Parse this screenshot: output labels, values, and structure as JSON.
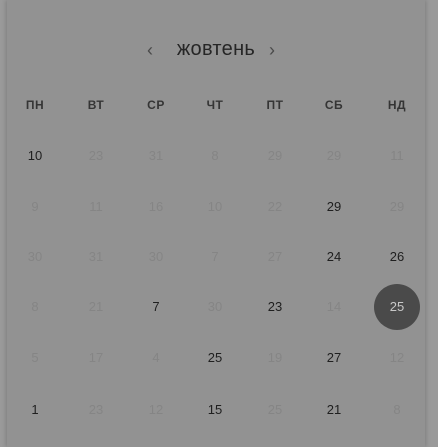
{
  "header": {
    "month": "жовтень",
    "prev_icon": "chevron-left-icon",
    "next_icon": "chevron-right-icon"
  },
  "weekdays": [
    "ПН",
    "ВТ",
    "СР",
    "ЧТ",
    "ПТ",
    "СБ",
    "НД"
  ],
  "weeks": [
    [
      {
        "text": "10",
        "muted": false
      },
      {
        "text": "23",
        "muted": true
      },
      {
        "text": "31",
        "muted": true
      },
      {
        "text": "8",
        "muted": true
      },
      {
        "text": "29",
        "muted": true
      },
      {
        "text": "29",
        "muted": true
      },
      {
        "text": "11",
        "muted": true
      }
    ],
    [
      {
        "text": "9",
        "muted": true
      },
      {
        "text": "11",
        "muted": true
      },
      {
        "text": "16",
        "muted": true
      },
      {
        "text": "10",
        "muted": true
      },
      {
        "text": "22",
        "muted": true
      },
      {
        "text": "29",
        "muted": false
      },
      {
        "text": "29",
        "muted": true
      }
    ],
    [
      {
        "text": "30",
        "muted": true
      },
      {
        "text": "31",
        "muted": true
      },
      {
        "text": "30",
        "muted": true
      },
      {
        "text": "7",
        "muted": true
      },
      {
        "text": "27",
        "muted": true
      },
      {
        "text": "24",
        "muted": false
      },
      {
        "text": "26",
        "muted": false
      }
    ],
    [
      {
        "text": "8",
        "muted": true
      },
      {
        "text": "21",
        "muted": true
      },
      {
        "text": "7",
        "muted": false
      },
      {
        "text": "30",
        "muted": true
      },
      {
        "text": "23",
        "muted": false
      },
      {
        "text": "14",
        "muted": true
      },
      {
        "text": "25",
        "muted": false,
        "selected": true
      }
    ],
    [
      {
        "text": "5",
        "muted": true
      },
      {
        "text": "17",
        "muted": true
      },
      {
        "text": "4",
        "muted": true
      },
      {
        "text": "25",
        "muted": false
      },
      {
        "text": "19",
        "muted": true
      },
      {
        "text": "27",
        "muted": false
      },
      {
        "text": "12",
        "muted": true
      }
    ],
    [
      {
        "text": "1",
        "muted": false
      },
      {
        "text": "23",
        "muted": true
      },
      {
        "text": "12",
        "muted": true
      },
      {
        "text": "15",
        "muted": false
      },
      {
        "text": "25",
        "muted": true
      },
      {
        "text": "21",
        "muted": false
      },
      {
        "text": "8",
        "muted": true
      }
    ]
  ],
  "colors": {
    "background": "#9a9a9a",
    "panel": "#929292",
    "selected": "#4a4a4a"
  }
}
